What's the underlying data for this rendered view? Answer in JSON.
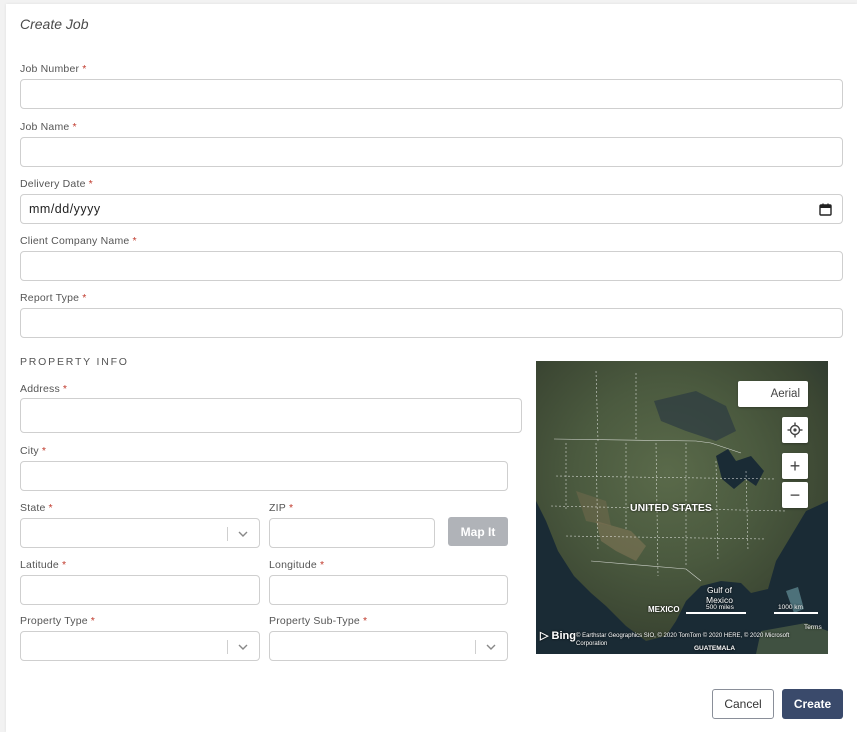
{
  "form": {
    "title": "Create Job",
    "required_mark": "*",
    "fields": {
      "job_number": {
        "label": "Job Number",
        "value": ""
      },
      "job_name": {
        "label": "Job Name",
        "value": ""
      },
      "delivery_date": {
        "label": "Delivery Date",
        "placeholder": "mm/dd/yyyy"
      },
      "client_company": {
        "label": "Client Company Name",
        "value": ""
      },
      "report_type": {
        "label": "Report Type",
        "value": ""
      }
    }
  },
  "property": {
    "section_title": "PROPERTY INFO",
    "address": {
      "label": "Address",
      "value": ""
    },
    "city": {
      "label": "City",
      "value": ""
    },
    "state": {
      "label": "State",
      "value": ""
    },
    "zip": {
      "label": "ZIP",
      "value": ""
    },
    "map_it_label": "Map It",
    "latitude": {
      "label": "Latitude",
      "value": ""
    },
    "longitude": {
      "label": "Longitude",
      "value": ""
    },
    "property_type": {
      "label": "Property Type",
      "value": ""
    },
    "property_sub_type": {
      "label": "Property Sub-Type",
      "value": ""
    }
  },
  "map": {
    "view_mode": "Aerial",
    "country_label": "UNITED STATES",
    "gulf_label_1": "Gulf of",
    "gulf_label_2": "Mexico",
    "mexico_label": "MEXICO",
    "guatemala_label": "GUATEMALA",
    "scale_miles": "500 miles",
    "scale_km": "1000 km",
    "brand": "Bing",
    "attribution": "© Earthstar Geographics SIO, © 2020 TomTom © 2020 HERE, © 2020 Microsoft Corporation",
    "terms": "Terms",
    "zoom_in": "+",
    "zoom_out": "−"
  },
  "actions": {
    "cancel_label": "Cancel",
    "create_label": "Create"
  },
  "colors": {
    "required": "#c0392b",
    "primary_button": "#3a4a6b",
    "map_it_disabled": "#b0b3b8"
  }
}
